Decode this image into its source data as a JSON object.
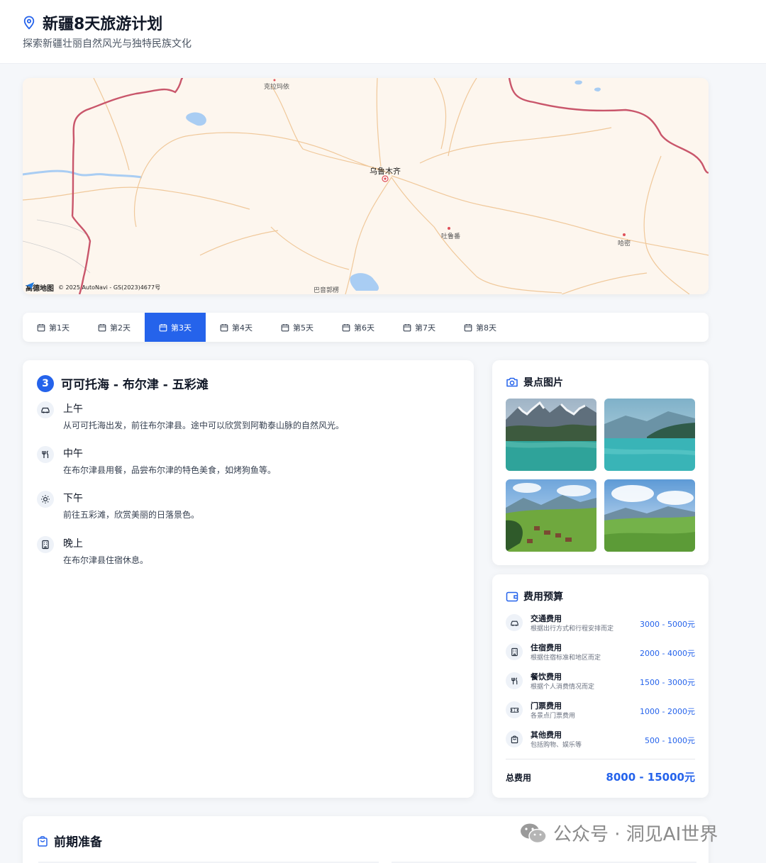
{
  "header": {
    "title": "新疆8天旅游计划",
    "subtitle": "探索新疆壮丽自然风光与独特民族文化",
    "icon": "map-pin-icon"
  },
  "map": {
    "labels": {
      "karamay": "克拉玛依",
      "urumqi": "乌鲁木齐",
      "turpan": "吐鲁番",
      "hami": "哈密",
      "bayinguoleng": "巴音郭楞"
    },
    "logo": "高德地图",
    "copyright": "© 2025 AutoNavi - GS(2023)4677号"
  },
  "tabs": [
    {
      "label": "第1天",
      "active": false
    },
    {
      "label": "第2天",
      "active": false
    },
    {
      "label": "第3天",
      "active": true
    },
    {
      "label": "第4天",
      "active": false
    },
    {
      "label": "第5天",
      "active": false
    },
    {
      "label": "第6天",
      "active": false
    },
    {
      "label": "第7天",
      "active": false
    },
    {
      "label": "第8天",
      "active": false
    }
  ],
  "day": {
    "number": "3",
    "title": "可可托海 - 布尔津 - 五彩滩",
    "activities": [
      {
        "time": "上午",
        "icon": "car-icon",
        "description": "从可可托海出发，前往布尔津县。途中可以欣赏到阿勒泰山脉的自然风光。"
      },
      {
        "time": "中午",
        "icon": "utensils-icon",
        "description": "在布尔津县用餐，品尝布尔津的特色美食，如烤狗鱼等。"
      },
      {
        "time": "下午",
        "icon": "sun-icon",
        "description": "前往五彩滩，欣赏美丽的日落景色。"
      },
      {
        "time": "晚上",
        "icon": "hotel-icon",
        "description": "在布尔津县住宿休息。"
      }
    ]
  },
  "photos": {
    "title": "景点图片",
    "icon": "camera-icon",
    "items": [
      "mountain-lake-photo",
      "turquoise-lake-photo",
      "village-meadow-photo",
      "grassland-photo"
    ]
  },
  "budget": {
    "title": "费用预算",
    "icon": "wallet-icon",
    "items": [
      {
        "name": "交通费用",
        "note": "根据出行方式和行程安排而定",
        "value": "3000 - 5000元",
        "icon": "car-icon"
      },
      {
        "name": "住宿费用",
        "note": "根据住宿标准和地区而定",
        "value": "2000 - 4000元",
        "icon": "hotel-icon"
      },
      {
        "name": "餐饮费用",
        "note": "根据个人消费情况而定",
        "value": "1500 - 3000元",
        "icon": "utensils-icon"
      },
      {
        "name": "门票费用",
        "note": "各景点门票费用",
        "value": "1000 - 2000元",
        "icon": "ticket-icon"
      },
      {
        "name": "其他费用",
        "note": "包括购物、娱乐等",
        "value": "500 - 1000元",
        "icon": "shopping-bag-icon"
      }
    ],
    "total_label": "总费用",
    "total_value": "8000 - 15000元"
  },
  "prep": {
    "title": "前期准备",
    "icon": "shopping-bag-icon"
  },
  "watermark": "公众号 · 洞见AI世界",
  "colors": {
    "accent": "#2563eb",
    "border_line": "#c9566b",
    "road": "#f0c89a",
    "water": "#a9cdf3"
  }
}
